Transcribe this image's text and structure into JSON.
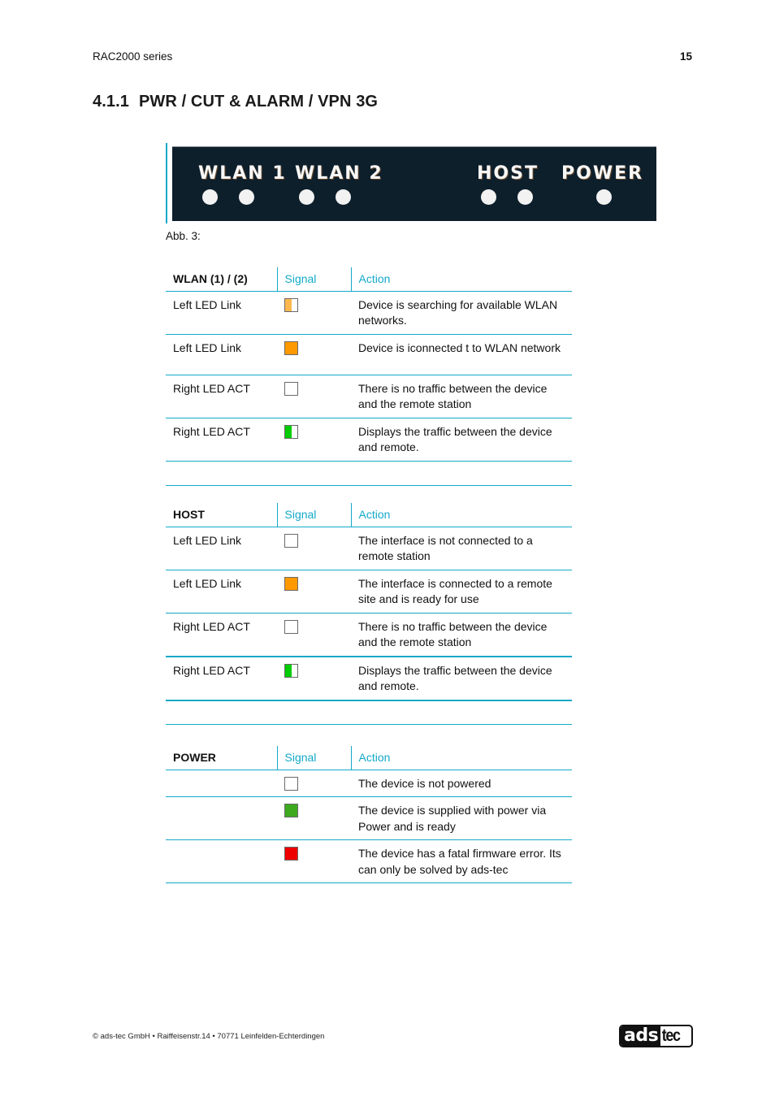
{
  "header": {
    "series": "RAC2000 series",
    "page_number": "15"
  },
  "section": {
    "number": "4.1.1",
    "title": "PWR / CUT & ALARM / VPN 3G"
  },
  "figure": {
    "labels": [
      "WLAN 1",
      "WLAN 2",
      "HOST",
      "POWER"
    ],
    "led_count": 7,
    "caption": "Abb. 3:"
  },
  "tables": {
    "wlan": {
      "headers": [
        "WLAN (1) / (2)",
        "Signal",
        "Action"
      ],
      "rows": [
        {
          "led": "Left LED Link",
          "signal": "orange-blinking",
          "signal_color": "#ffb84d",
          "action": "Device is searching for available WLAN networks."
        },
        {
          "led": "Left LED Link",
          "signal": "orange-on",
          "signal_color": "#ff9900",
          "action": "Device is iconnected t to WLAN network"
        },
        {
          "led": "Right LED ACT",
          "signal": "off",
          "signal_color": "#ffffff",
          "action": "There is no traffic between the device and the remote station"
        },
        {
          "led": "Right LED ACT",
          "signal": "green-blinking",
          "signal_color": "#00cc00",
          "action": "Displays the traffic between the device and remote."
        }
      ]
    },
    "host": {
      "headers": [
        "HOST",
        "Signal",
        "Action"
      ],
      "rows": [
        {
          "led": "Left LED Link",
          "signal": "off",
          "signal_color": "#ffffff",
          "action": "The interface is not connected to a remote station"
        },
        {
          "led": "Left LED Link",
          "signal": "orange-on",
          "signal_color": "#ff9900",
          "action": "The interface is connected to a remote site and is ready for use"
        },
        {
          "led": "Right LED ACT",
          "signal": "off",
          "signal_color": "#ffffff",
          "action": "There is no traffic between the device and the remote station"
        },
        {
          "led": "Right LED ACT",
          "signal": "green-blinking",
          "signal_color": "#00cc00",
          "action": "Displays the traffic between the device and remote."
        }
      ]
    },
    "power": {
      "headers": [
        "POWER",
        "Signal",
        "Action"
      ],
      "rows": [
        {
          "led": "",
          "signal": "off",
          "signal_color": "#ffffff",
          "action": "The device is not powered"
        },
        {
          "led": "",
          "signal": "green-on",
          "signal_color": "#3daa1e",
          "action": "The device is supplied with power via Power and is ready"
        },
        {
          "led": "",
          "signal": "red-on",
          "signal_color": "#ee0000",
          "action": "The device has a fatal firmware error. Its can only be solved by ads-tec"
        }
      ]
    }
  },
  "colors": {
    "accent": "#13a9c9",
    "panel_bg": "#0e1f2c"
  },
  "footer": {
    "address": "© ads-tec GmbH • Raiffeisenstr.14 • 70771 Leinfelden-Echterdingen",
    "logo_left": "ads",
    "logo_right": "tec"
  }
}
